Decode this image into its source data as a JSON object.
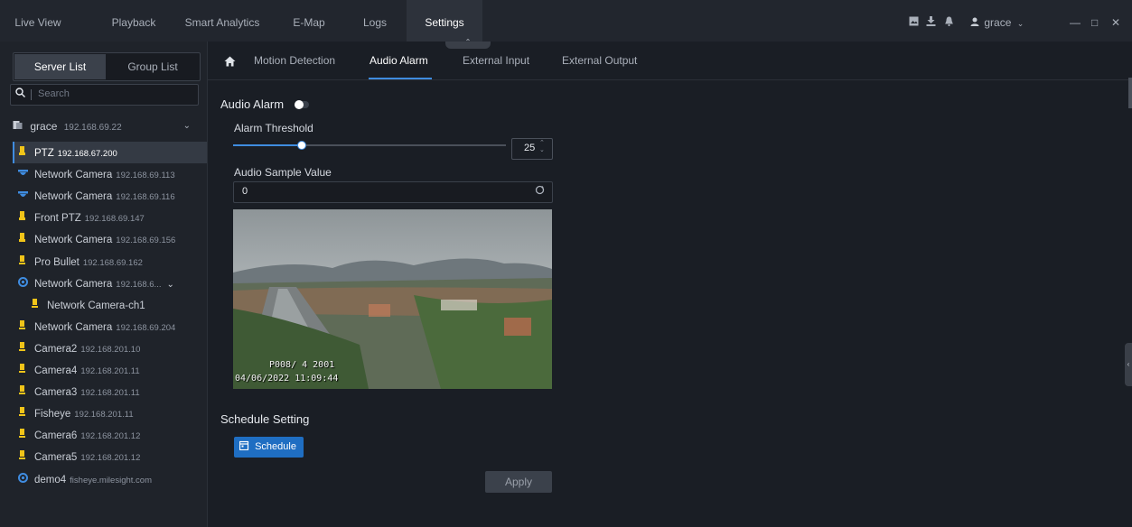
{
  "top_nav": {
    "tabs": [
      "Live View",
      "Playback",
      "Smart Analytics",
      "E-Map",
      "Logs",
      "Settings"
    ],
    "active_tab": "Settings",
    "user": "grace",
    "icons": [
      "image-icon",
      "download-icon",
      "bell-icon",
      "user-icon",
      "minimize-icon",
      "maximize-icon",
      "close-icon"
    ]
  },
  "sidebar": {
    "segments": [
      "Server List",
      "Group List"
    ],
    "active_segment": "Server List",
    "search_placeholder": "Search",
    "server": {
      "name": "grace",
      "ip": "192.168.69.22"
    },
    "devices": [
      {
        "name": "PTZ",
        "ip": "192.168.67.200",
        "icon": "ptz-icon",
        "selected": true
      },
      {
        "name": "Network Camera",
        "ip": "192.168.69.113",
        "icon": "dome-camera-icon"
      },
      {
        "name": "Network Camera",
        "ip": "192.168.69.116",
        "icon": "dome-camera-icon"
      },
      {
        "name": "Front PTZ",
        "ip": "192.168.69.147",
        "icon": "ptz-icon"
      },
      {
        "name": "Network Camera",
        "ip": "192.168.69.156",
        "icon": "ptz-icon"
      },
      {
        "name": "Pro Bullet",
        "ip": "192.168.69.162",
        "icon": "bullet-camera-icon"
      },
      {
        "name": "Network Camera",
        "ip": "192.168.6...",
        "icon": "fisheye-icon",
        "expandable": true
      },
      {
        "name": "Network Camera-ch1",
        "ip": "",
        "icon": "bullet-camera-icon",
        "child": true
      },
      {
        "name": "Network Camera",
        "ip": "192.168.69.204",
        "icon": "bullet-camera-icon"
      },
      {
        "name": "Camera2",
        "ip": "192.168.201.10",
        "icon": "bullet-camera-icon"
      },
      {
        "name": "Camera4",
        "ip": "192.168.201.11",
        "icon": "bullet-camera-icon"
      },
      {
        "name": "Camera3",
        "ip": "192.168.201.11",
        "icon": "bullet-camera-icon"
      },
      {
        "name": "Fisheye",
        "ip": "192.168.201.11",
        "icon": "bullet-camera-icon"
      },
      {
        "name": "Camera6",
        "ip": "192.168.201.12",
        "icon": "bullet-camera-icon"
      },
      {
        "name": "Camera5",
        "ip": "192.168.201.12",
        "icon": "bullet-camera-icon"
      },
      {
        "name": "demo4",
        "ip": "fisheye.milesight.com",
        "icon": "fisheye-icon"
      }
    ]
  },
  "settings": {
    "subtabs": [
      "Motion Detection",
      "Audio Alarm",
      "External Input",
      "External Output"
    ],
    "active_subtab": "Audio Alarm",
    "audio_alarm_label": "Audio Alarm",
    "audio_alarm_enabled": false,
    "alarm_threshold_label": "Alarm Threshold",
    "alarm_threshold_value": "25",
    "alarm_threshold_fraction": 0.25,
    "audio_sample_label": "Audio Sample Value",
    "audio_sample_value": "0",
    "video_osd_timestamp": "04/06/2022 11:09:44",
    "video_osd_text": "P008/ 4   2001",
    "schedule_setting_label": "Schedule Setting",
    "schedule_button": "Schedule",
    "apply_button": "Apply"
  },
  "colors": {
    "accent": "#3f8ce0",
    "button_primary": "#1f6ec2",
    "background": "#1a1e25"
  }
}
